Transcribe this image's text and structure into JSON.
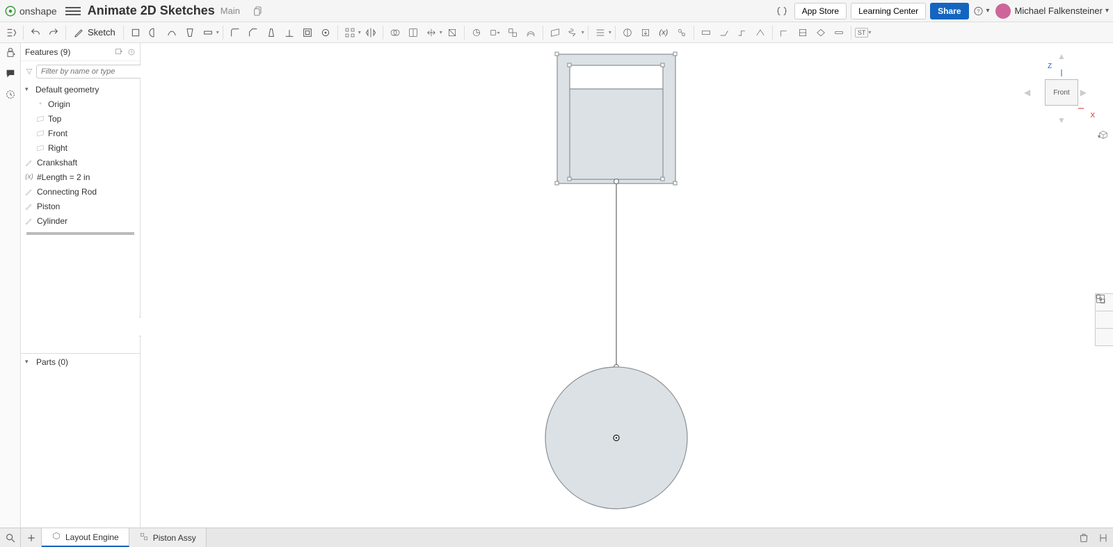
{
  "header": {
    "logo_text": "onshape",
    "doc_title": "Animate 2D Sketches",
    "doc_subtitle": "Main",
    "app_store": "App Store",
    "learning_center": "Learning Center",
    "share": "Share",
    "user_name": "Michael Falkensteiner"
  },
  "toolbar": {
    "sketch_label": "Sketch",
    "st_label": "ST"
  },
  "panel": {
    "features_label": "Features (9)",
    "filter_placeholder": "Filter by name or type",
    "default_geometry": "Default geometry",
    "origin": "Origin",
    "planes": [
      "Top",
      "Front",
      "Right"
    ],
    "feat_crankshaft": "Crankshaft",
    "feat_length": "#Length = 2 in",
    "feat_connecting_rod": "Connecting Rod",
    "feat_piston": "Piston",
    "feat_cylinder": "Cylinder",
    "parts_label": "Parts (0)"
  },
  "viewcube": {
    "face": "Front",
    "axis_z": "Z",
    "axis_x": "X"
  },
  "footer": {
    "tabs": [
      {
        "label": "Layout Engine",
        "active": true
      },
      {
        "label": "Piston Assy",
        "active": false
      }
    ]
  }
}
